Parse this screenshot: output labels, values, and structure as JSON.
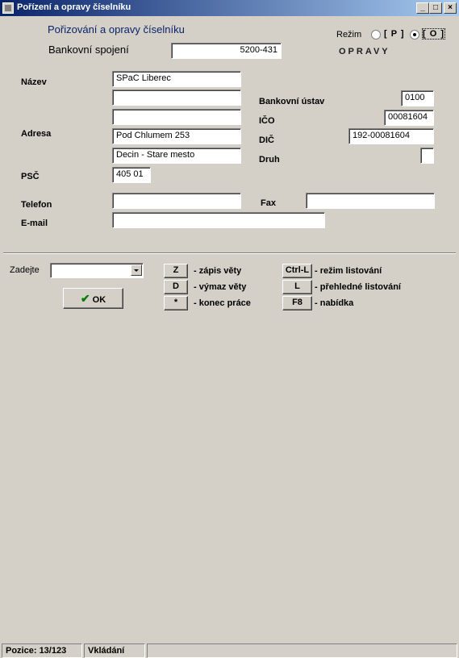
{
  "window": {
    "title": "Pořízení a opravy číselníku",
    "controls": {
      "minimize": "_",
      "maximize": "□",
      "close": "×"
    }
  },
  "header": {
    "heading": "Pořizování a opravy číselníku",
    "bank_label": "Bankovní spojení",
    "bank_value": "5200-431"
  },
  "mode": {
    "label": "Režim",
    "options": [
      "[ P ]",
      "[ O ]"
    ],
    "selected": "[ O ]",
    "state_text": "OPRAVY"
  },
  "form": {
    "nazev_label": "Název",
    "nazev_value": "SPaC Liberec",
    "nazev2_value": "",
    "nazev3_value": "",
    "adresa_label": "Adresa",
    "adresa1_value": "Pod Chlumem  253",
    "adresa2_value": "Decin - Stare mesto",
    "psc_label": "PSČ",
    "psc_value": "405 01",
    "telefon_label": "Telefon",
    "telefon_value": "",
    "email_label": "E-mail",
    "email_value": "",
    "bank_ustav_label": "Bankovní ústav",
    "bank_ustav_value": "0100",
    "ico_label": "IČO",
    "ico_value": "00081604",
    "dic_label": "DIČ",
    "dic_value": "192-00081604",
    "druh_label": "Druh",
    "druh_value": "",
    "fax_label": "Fax",
    "fax_value": ""
  },
  "bottom": {
    "zadejte_label": "Zadejte",
    "zadejte_value": "",
    "ok_label": "OK",
    "keys": [
      {
        "key": "Z",
        "desc": "- zápis věty"
      },
      {
        "key": "D",
        "desc": "- výmaz věty"
      },
      {
        "key": "*",
        "desc": "- konec práce"
      },
      {
        "key": "Ctrl-L",
        "desc": "- režim listování"
      },
      {
        "key": "L",
        "desc": "- přehledné listování"
      },
      {
        "key": "F8",
        "desc": "- nabídka"
      }
    ]
  },
  "status": {
    "pozice": "Pozice: 13/123",
    "mode": "Vkládání",
    "empty": ""
  }
}
